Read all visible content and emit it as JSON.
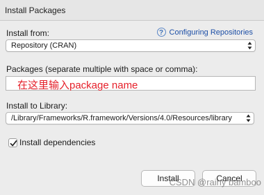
{
  "window": {
    "title": "Install Packages"
  },
  "install_from": {
    "label": "Install from:",
    "help_icon": "question-circle-icon",
    "help_link": "Configuring Repositories",
    "selected": "Repository (CRAN)"
  },
  "packages": {
    "label": "Packages (separate multiple with space or comma):",
    "value": "在这里输入package name"
  },
  "library": {
    "label": "Install to Library:",
    "selected": "/Library/Frameworks/R.framework/Versions/4.0/Resources/library"
  },
  "dependencies": {
    "label": "Install dependencies",
    "checked": true
  },
  "buttons": {
    "install": "Install",
    "cancel": "Cancel"
  },
  "watermark": "CSDN @rainy bamboo",
  "colors": {
    "link": "#1d4fa6",
    "annotation": "#e5202a"
  }
}
